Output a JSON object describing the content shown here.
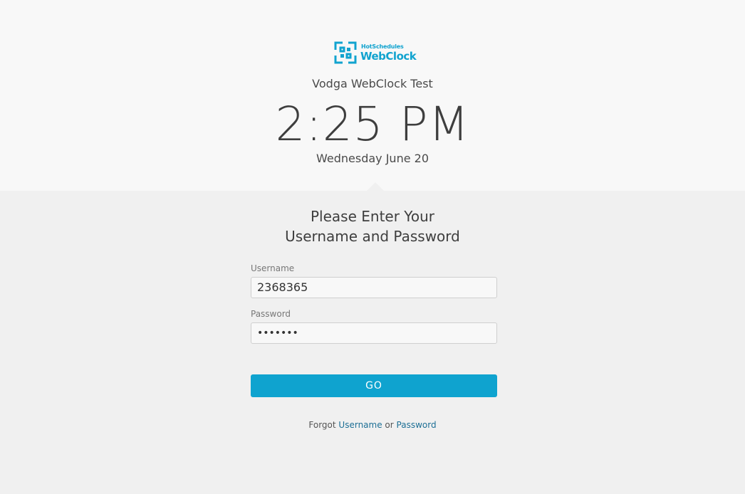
{
  "brand": {
    "small_text": "HotSchedules",
    "big_text": "WebClock",
    "color": "#11a3cf"
  },
  "header": {
    "site_name": "Vodga WebClock Test",
    "time": "2:25 PM",
    "date": "Wednesday June 20"
  },
  "login": {
    "heading_line1": "Please Enter Your",
    "heading_line2": "Username and Password",
    "username_label": "Username",
    "username_value": "2368365",
    "password_label": "Password",
    "password_value": "•••••••",
    "go_label": "GO",
    "go_color": "#0fa3cf"
  },
  "forgot": {
    "prefix": "Forgot",
    "username_link": "Username",
    "or": "or",
    "password_link": "Password"
  }
}
